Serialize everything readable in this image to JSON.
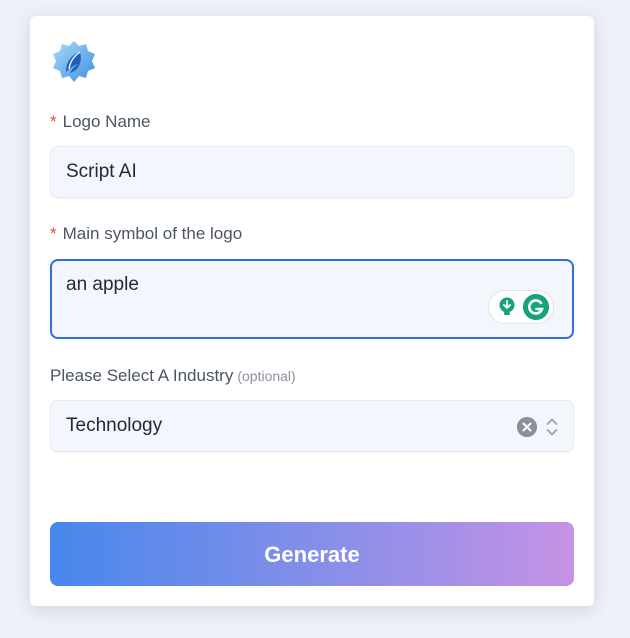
{
  "form": {
    "logo_icon": "gear-feather-logo-icon",
    "logo_name": {
      "required_mark": "*",
      "label": "Logo Name",
      "value": "Script AI"
    },
    "main_symbol": {
      "required_mark": "*",
      "label": "Main symbol of the logo",
      "value": "an apple"
    },
    "industry": {
      "label": "Please Select A Industry",
      "optional_label": "(optional)",
      "selected": "Technology"
    },
    "generate_label": "Generate"
  },
  "colors": {
    "required": "#e0542c",
    "focus_border": "#2f6fe0",
    "gradient_start": "#4787ec",
    "gradient_end": "#c592e6",
    "grammarly": "#15a37b"
  },
  "icons": {
    "grammarly_suggest": "lightbulb-icon",
    "grammarly_logo": "grammarly-logo-icon",
    "clear": "clear-icon",
    "select_toggle": "chevron-up-down-icon"
  }
}
